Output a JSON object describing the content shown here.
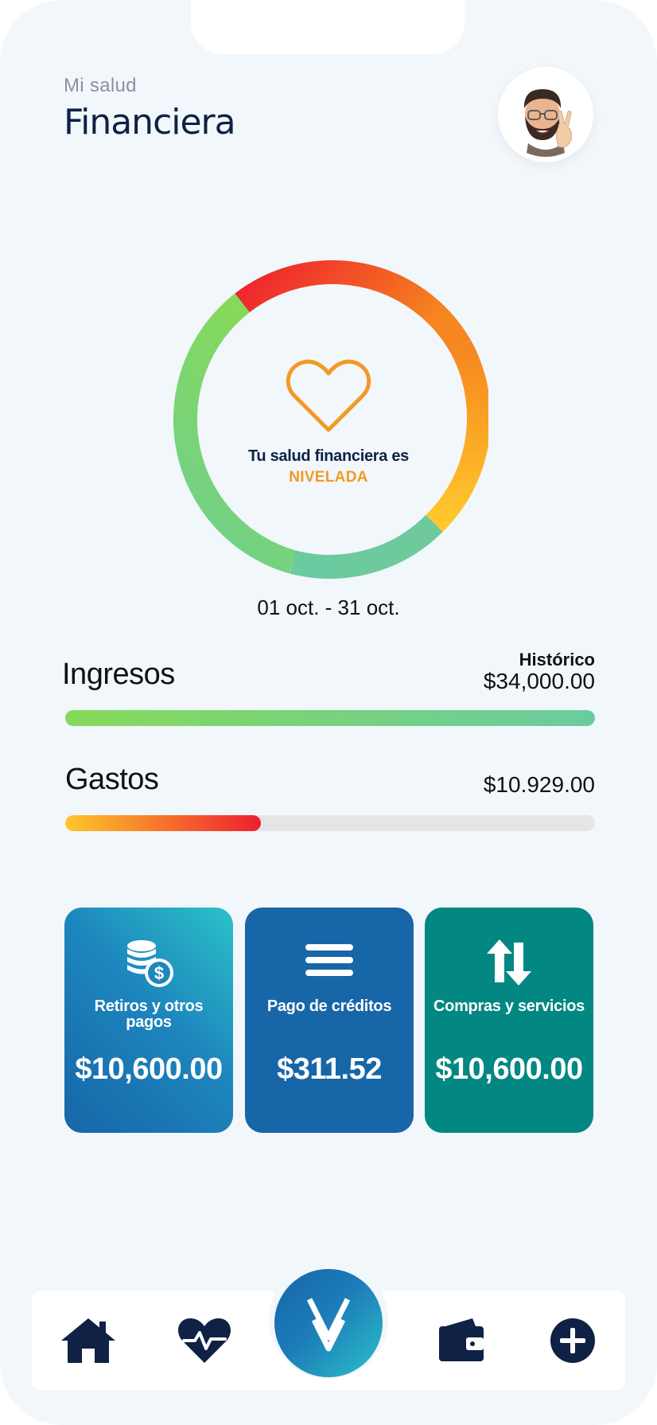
{
  "header": {
    "subtitle": "Mi salud",
    "title": "Financiera"
  },
  "gauge": {
    "label": "Tu salud financiera es",
    "status": "NIVELADA",
    "segments": [
      {
        "name": "red",
        "color": "#ee1f2e"
      },
      {
        "name": "orange",
        "color": "#f6861f"
      },
      {
        "name": "yellow",
        "color": "#ffc82c"
      },
      {
        "name": "teal-green",
        "color": "#6acba0"
      },
      {
        "name": "green",
        "color": "#86d95a"
      }
    ],
    "icon": "heart-outline-icon"
  },
  "period": "01 oct. - 31 oct.",
  "income": {
    "title": "Ingresos",
    "historic_label": "Histórico",
    "amount": "$34,000.00",
    "progress": 1.0,
    "color_start": "#86d95a",
    "color_end": "#6acba0"
  },
  "expenses": {
    "title": "Gastos",
    "amount": "$10.929.00",
    "progress": 0.37,
    "color_start": "#ffc82c",
    "color_end": "#ee1f2e"
  },
  "cards": [
    {
      "label": "Retiros y otros pagos",
      "value": "$10,600.00",
      "icon": "coins-dollar-icon"
    },
    {
      "label": "Pago de créditos",
      "value": "$311.52",
      "icon": "menu-lines-icon"
    },
    {
      "label": "Compras y servicios",
      "value": "$10,600.00",
      "icon": "arrows-up-down-icon"
    }
  ],
  "nav": {
    "items": [
      {
        "name": "home",
        "icon": "home-icon"
      },
      {
        "name": "health",
        "icon": "heart-pulse-icon"
      },
      {
        "name": "center",
        "icon": "v-logo-icon"
      },
      {
        "name": "wallet",
        "icon": "wallet-icon"
      },
      {
        "name": "add",
        "icon": "plus-circle-icon"
      }
    ]
  },
  "colors": {
    "background": "#f2f7fb",
    "navy": "#0f2245",
    "card_blue_gradient": [
      "#1766a8",
      "#2bc2c8"
    ],
    "card_blue": "#1766a8",
    "card_teal": "#028782",
    "accent_orange": "#f29a26"
  }
}
